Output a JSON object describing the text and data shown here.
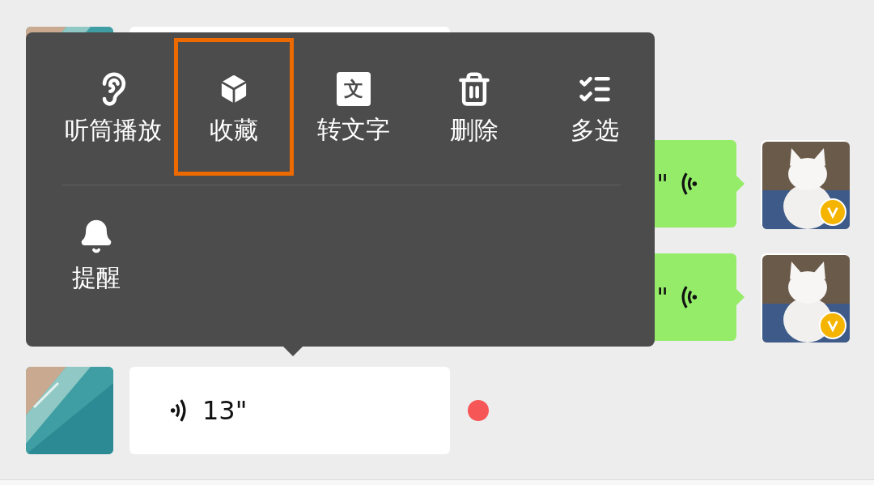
{
  "messages": [
    {
      "kind": "received",
      "unread": false
    },
    {
      "kind": "sent",
      "duration": "\""
    },
    {
      "kind": "sent",
      "duration": "\""
    },
    {
      "kind": "received",
      "duration": "13\"",
      "unread": true
    }
  ],
  "context_menu": {
    "items": [
      {
        "kind": "ear",
        "label": "听筒播放",
        "highlighted": false
      },
      {
        "kind": "cube",
        "label": "收藏",
        "highlighted": true
      },
      {
        "kind": "text",
        "label": "转文字",
        "icon_text": "文",
        "highlighted": false
      },
      {
        "kind": "trash",
        "label": "删除",
        "highlighted": false
      },
      {
        "kind": "multiselect",
        "label": "多选",
        "highlighted": false
      },
      {
        "kind": "bell",
        "label": "提醒",
        "highlighted": false
      }
    ]
  }
}
